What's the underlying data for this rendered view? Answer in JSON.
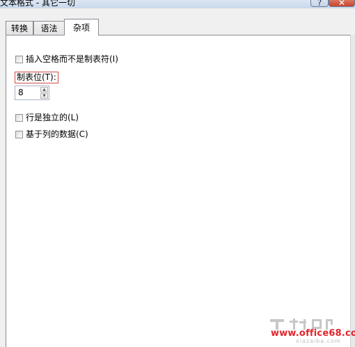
{
  "window": {
    "title": "文本格式 - 其它一切",
    "help_glyph": "?",
    "close_glyph": "✕"
  },
  "tabs": [
    {
      "label": "转换",
      "active": false
    },
    {
      "label": "语法",
      "active": false
    },
    {
      "label": "杂项",
      "active": true
    }
  ],
  "options": {
    "insert_spaces": {
      "label": "插入空格而不是制表符(I)",
      "checked": false
    },
    "tab_stop": {
      "label": "制表位(T):",
      "value": "8"
    },
    "line_independent": {
      "label": "行是独立的(L)",
      "checked": false
    },
    "column_based": {
      "label": "基于列的数据(C)",
      "checked": false
    }
  },
  "watermark": {
    "text": "www.office68.com",
    "subtext": "xiazaiba.com"
  },
  "colors": {
    "accent_red": "#e3232a",
    "group_border": "#d24a4a",
    "close_button": "#c8452d"
  }
}
